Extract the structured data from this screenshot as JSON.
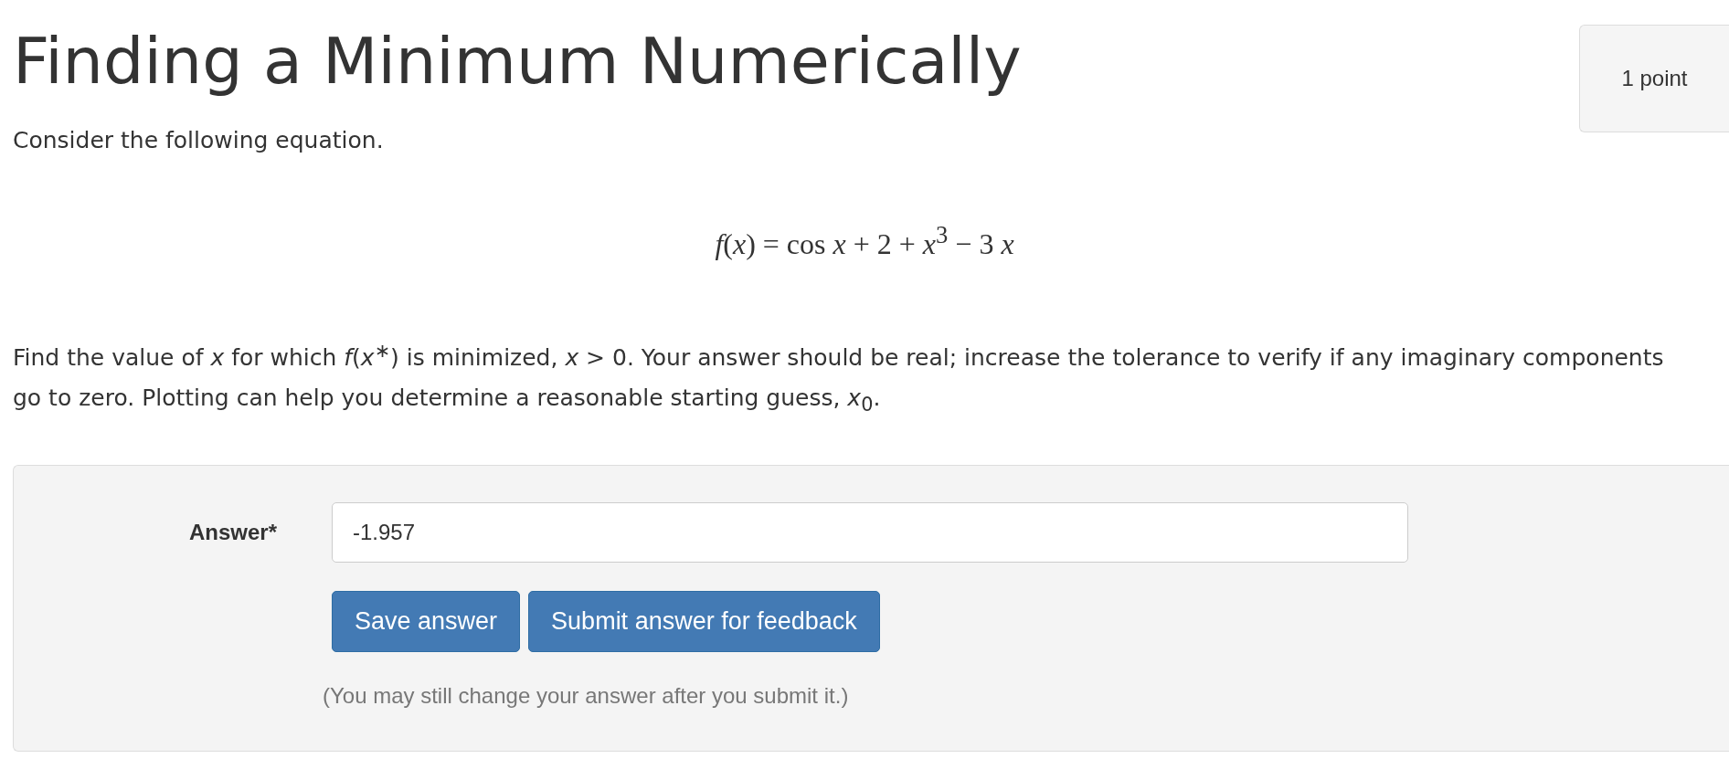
{
  "title": "Finding a Minimum Numerically",
  "points": "1 point",
  "intro": "Consider the following equation.",
  "equation": "*f*(*x*) = cos *x* + 2 + *x*$^{3}$ − 3 *x*",
  "question": "Find the value of *x* for which *f*(*x*$^{∗}$) is minimized, *x* > 0. Your answer should be real; increase the tolerance to verify if any imaginary components go to zero. Plotting can help you determine a reasonable starting guess, *x*$_{0}$.",
  "answer": {
    "label": "Answer*",
    "value": "-1.957"
  },
  "buttons": [
    {
      "label": "Save answer"
    },
    {
      "label": "Submit answer for feedback"
    }
  ],
  "note": "(You may still change your answer after you submit it.)"
}
